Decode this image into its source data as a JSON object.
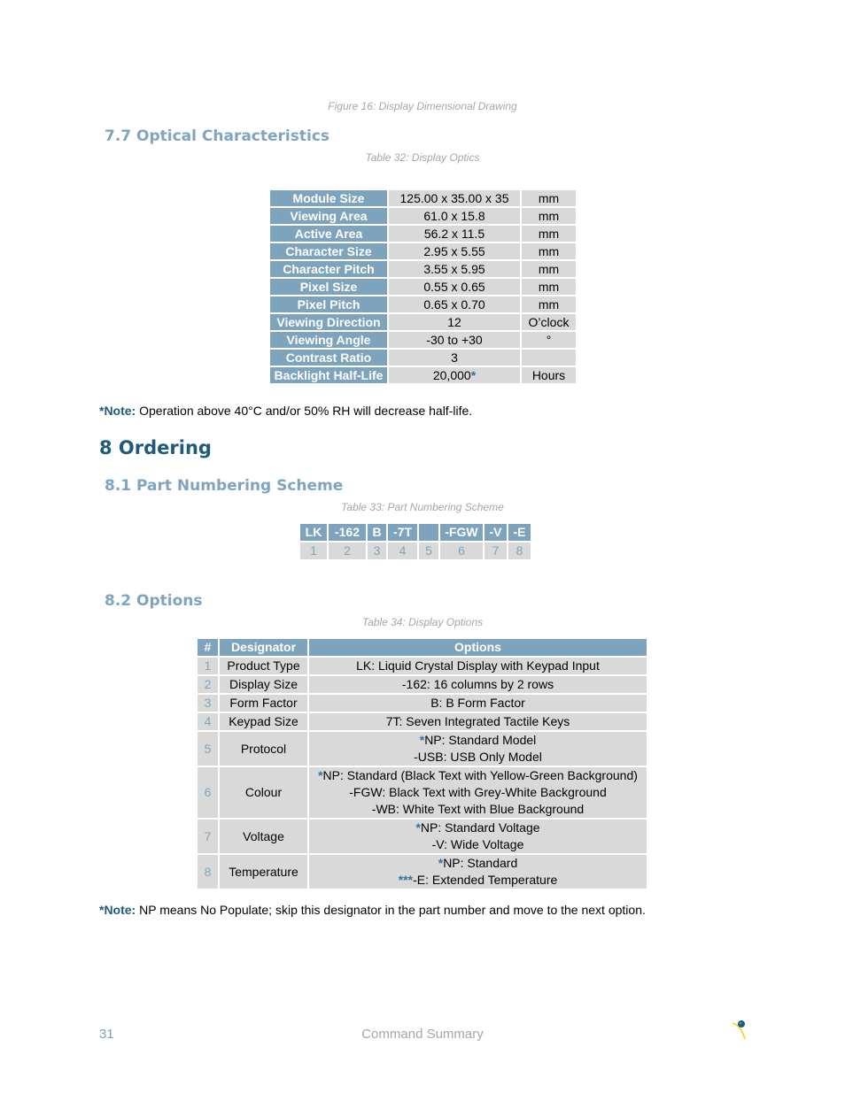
{
  "figure_caption": "Figure 16: Display Dimensional Drawing",
  "section_7_7": {
    "heading": "7.7 Optical Characteristics",
    "table_caption": "Table 32: Display Optics",
    "rows": [
      {
        "label": "Module Size",
        "value": "125.00 x 35.00 x 35",
        "star": "",
        "unit": "mm"
      },
      {
        "label": "Viewing Area",
        "value": "61.0 x 15.8",
        "star": "",
        "unit": "mm"
      },
      {
        "label": "Active Area",
        "value": "56.2 x 11.5",
        "star": "",
        "unit": "mm"
      },
      {
        "label": "Character Size",
        "value": "2.95 x 5.55",
        "star": "",
        "unit": "mm"
      },
      {
        "label": "Character Pitch",
        "value": "3.55 x 5.95",
        "star": "",
        "unit": "mm"
      },
      {
        "label": "Pixel Size",
        "value": "0.55 x 0.65",
        "star": "",
        "unit": "mm"
      },
      {
        "label": "Pixel Pitch",
        "value": "0.65 x 0.70",
        "star": "",
        "unit": "mm"
      },
      {
        "label": "Viewing Direction",
        "value": "12",
        "star": "",
        "unit": "O’clock"
      },
      {
        "label": "Viewing Angle",
        "value": "-30 to +30",
        "star": "",
        "unit": "°"
      },
      {
        "label": "Contrast Ratio",
        "value": "3",
        "star": "",
        "unit": ""
      },
      {
        "label": "Backlight Half-Life",
        "value": "20,000",
        "star": "*",
        "unit": "Hours"
      }
    ],
    "note_label": "*Note:",
    "note_text": " Operation above 40°C and/or 50% RH will decrease half-life."
  },
  "section_8": {
    "heading": "8 Ordering"
  },
  "section_8_1": {
    "heading": "8.1 Part Numbering Scheme",
    "table_caption": "Table 33: Part Numbering Scheme",
    "codes": [
      "LK",
      "-162",
      "B",
      "-7T",
      "",
      "-FGW",
      "-V",
      "-E"
    ],
    "positions": [
      "1",
      "2",
      "3",
      "4",
      "5",
      "6",
      "7",
      "8"
    ]
  },
  "section_8_2": {
    "heading": "8.2 Options",
    "table_caption": "Table 34: Display Options",
    "headers": {
      "num": "#",
      "designator": "Designator",
      "options": "Options"
    },
    "rows": [
      {
        "num": "1",
        "designator": "Product Type",
        "options": [
          {
            "star": "",
            "text": "LK: Liquid Crystal Display with Keypad Input"
          }
        ]
      },
      {
        "num": "2",
        "designator": "Display Size",
        "options": [
          {
            "star": "",
            "text": "-162: 16 columns by 2 rows"
          }
        ]
      },
      {
        "num": "3",
        "designator": "Form Factor",
        "options": [
          {
            "star": "",
            "text": "B: B Form Factor"
          }
        ]
      },
      {
        "num": "4",
        "designator": "Keypad Size",
        "options": [
          {
            "star": "",
            "text": "7T: Seven Integrated Tactile Keys"
          }
        ]
      },
      {
        "num": "5",
        "designator": "Protocol",
        "options": [
          {
            "star": "*",
            "text": "NP: Standard Model"
          },
          {
            "star": "",
            "text": "-USB: USB Only Model"
          }
        ]
      },
      {
        "num": "6",
        "designator": "Colour",
        "options": [
          {
            "star": "*",
            "text": "NP: Standard (Black Text with Yellow-Green Background)"
          },
          {
            "star": "",
            "text": "-FGW: Black Text with Grey-White Background"
          },
          {
            "star": "",
            "text": "-WB: White Text with Blue Background"
          }
        ]
      },
      {
        "num": "7",
        "designator": "Voltage",
        "options": [
          {
            "star": "*",
            "text": "NP: Standard Voltage"
          },
          {
            "star": "",
            "text": "-V: Wide Voltage"
          }
        ]
      },
      {
        "num": "8",
        "designator": "Temperature",
        "options": [
          {
            "star": "*",
            "text": "NP: Standard"
          },
          {
            "star": "***",
            "text": "-E: Extended Temperature"
          }
        ]
      }
    ],
    "note_label": "*Note:",
    "note_text": " NP means No Populate; skip this designator in the part number and move to the next option."
  },
  "footer": {
    "page_number": "31",
    "title": "Command Summary",
    "logo_icon": "matrix-orbital-logo-icon"
  },
  "colors": {
    "table_header": "#7ea4bd",
    "table_cell": "#d9d9d9",
    "heading_dark": "#1f5a7a",
    "heading_light": "#7fa4bf"
  }
}
